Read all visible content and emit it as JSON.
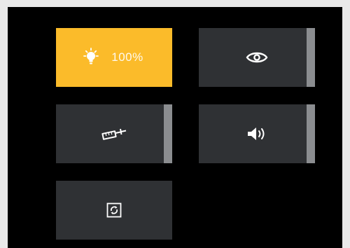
{
  "colors": {
    "panel_bg": "#000000",
    "tile_bg": "#2f3134",
    "tile_active": "#fbbb2a",
    "slider_bar": "#8b8d90",
    "icon": "#ffffff"
  },
  "tiles": [
    {
      "id": "brightness",
      "icon": "lightbulb-icon",
      "value": "100%",
      "active": true
    },
    {
      "id": "visibility",
      "icon": "eye-icon",
      "has_slider": true
    },
    {
      "id": "syringe",
      "icon": "syringe-icon",
      "has_slider": true
    },
    {
      "id": "volume",
      "icon": "speaker-icon",
      "has_slider": true
    },
    {
      "id": "refresh",
      "icon": "refresh-icon"
    }
  ]
}
